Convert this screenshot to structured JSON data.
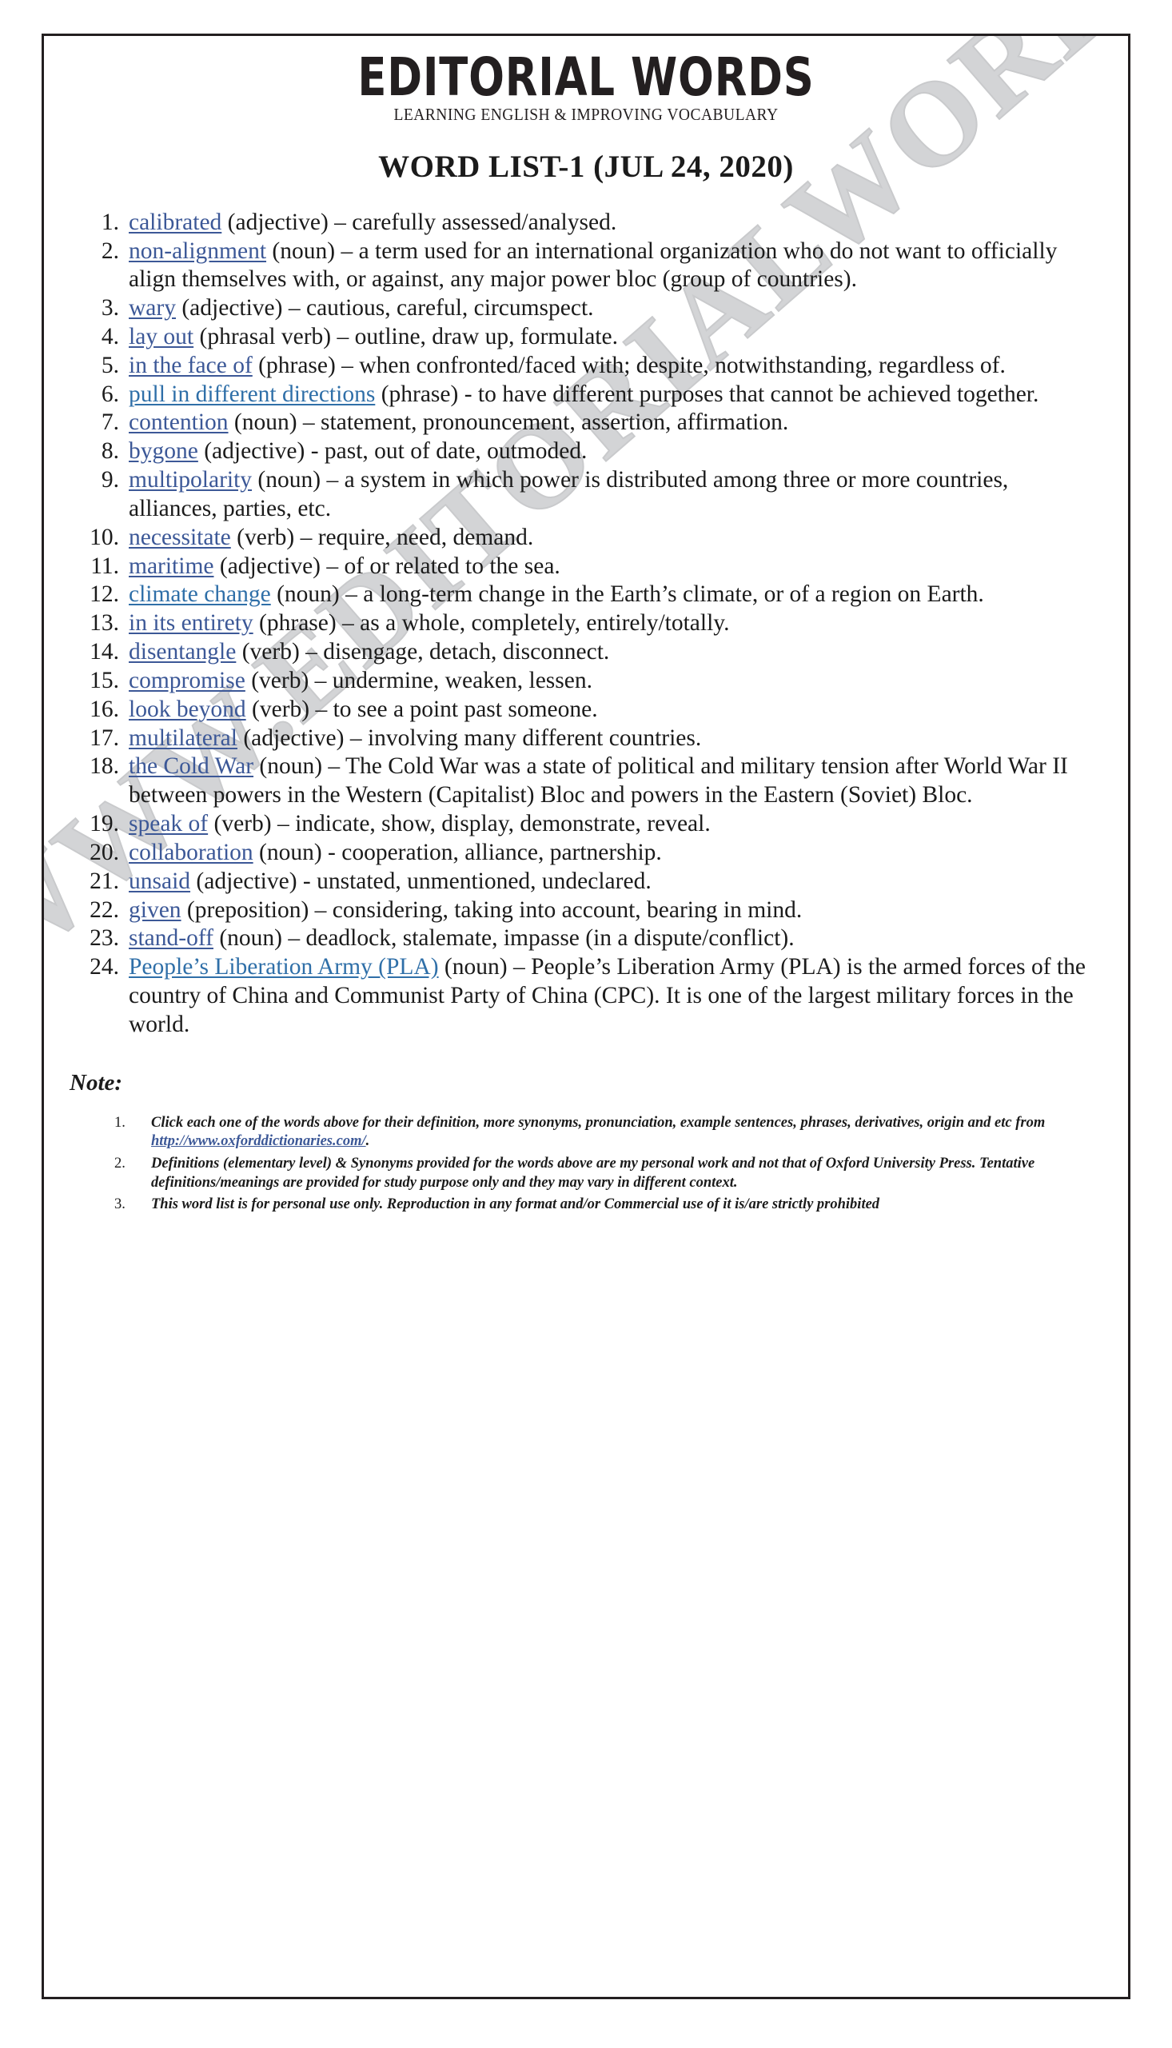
{
  "masthead": {
    "brand": "EDITORIAL WORDS",
    "tagline": "LEARNING ENGLISH & IMPROVING VOCABULARY"
  },
  "doc_title": "WORD LIST-1 (JUL 24, 2020)",
  "watermark": "WWW.EDITORIALWORDS.COM",
  "colors": {
    "link_blue": "#3c5897",
    "link_blue_alt": "#2f6fa8",
    "text_black": "#1b1b1b",
    "border": "#231f20",
    "watermark_gray": "#d3d4d6"
  },
  "words": [
    {
      "num": "1.",
      "term": "calibrated",
      "alt": false,
      "definition": " (adjective) – carefully assessed/analysed."
    },
    {
      "num": "2.",
      "term": "non-alignment",
      "alt": false,
      "definition": " (noun) – a term used for an international organization who do not want to officially align themselves with, or against, any major power bloc (group of countries)."
    },
    {
      "num": "3.",
      "term": "wary",
      "alt": false,
      "definition": " (adjective) – cautious, careful, circumspect."
    },
    {
      "num": "4.",
      "term": "lay out",
      "alt": false,
      "definition": " (phrasal verb) – outline, draw up, formulate."
    },
    {
      "num": "5.",
      "term": "in the face of",
      "alt": false,
      "definition": " (phrase) – when confronted/faced with; despite, notwithstanding, regardless of."
    },
    {
      "num": "6.",
      "term": "pull in different directions",
      "alt": true,
      "definition": " (phrase) - to have different purposes that cannot be achieved together."
    },
    {
      "num": "7.",
      "term": "contention",
      "alt": false,
      "definition": " (noun) – statement, pronouncement, assertion, affirmation."
    },
    {
      "num": "8.",
      "term": "bygone",
      "alt": false,
      "definition": " (adjective) - past, out of date, outmoded."
    },
    {
      "num": "9.",
      "term": "multipolarity",
      "alt": false,
      "definition": " (noun) – a system in which power is distributed among three or more countries, alliances, parties, etc."
    },
    {
      "num": "10.",
      "term": "necessitate",
      "alt": false,
      "definition": " (verb) – require, need, demand."
    },
    {
      "num": "11.",
      "term": "maritime",
      "alt": false,
      "definition": " (adjective) – of or related to the sea."
    },
    {
      "num": "12.",
      "term": "climate change",
      "alt": true,
      "definition": " (noun) – a long-term change in the Earth’s climate, or of a region on Earth."
    },
    {
      "num": "13.",
      "term": "in its entirety",
      "alt": false,
      "definition": " (phrase) – as a whole, completely, entirely/totally."
    },
    {
      "num": "14.",
      "term": "disentangle",
      "alt": false,
      "definition": " (verb) – disengage, detach, disconnect."
    },
    {
      "num": "15.",
      "term": "compromise",
      "alt": false,
      "definition": " (verb) – undermine, weaken, lessen."
    },
    {
      "num": "16.",
      "term": "look beyond",
      "alt": false,
      "definition": " (verb) – to see a point past someone."
    },
    {
      "num": "17.",
      "term": "multilateral",
      "alt": false,
      "definition": " (adjective) – involving many different countries."
    },
    {
      "num": "18.",
      "term": "the Cold War",
      "alt": false,
      "definition": " (noun) – The Cold War was a state of political and military tension after World War II between powers in the Western (Capitalist) Bloc and powers in the Eastern (Soviet) Bloc."
    },
    {
      "num": "19.",
      "term": "speak of",
      "alt": false,
      "definition": " (verb) – indicate, show, display, demonstrate, reveal."
    },
    {
      "num": "20.",
      "term": "collaboration",
      "alt": false,
      "definition": " (noun) - cooperation, alliance, partnership."
    },
    {
      "num": "21.",
      "term": "unsaid",
      "alt": false,
      "definition": " (adjective) - unstated, unmentioned, undeclared."
    },
    {
      "num": "22.",
      "term": "given",
      "alt": false,
      "definition": " (preposition) – considering, taking into account, bearing in mind."
    },
    {
      "num": "23.",
      "term": "stand-off",
      "alt": false,
      "definition": " (noun) – deadlock, stalemate, impasse (in a dispute/conflict)."
    },
    {
      "num": "24.",
      "term": "People’s Liberation Army (PLA)",
      "alt": true,
      "definition": " (noun) – People’s Liberation Army (PLA) is the armed forces of the country of China and Communist Party of China (CPC). It is one of the largest military forces in the world."
    }
  ],
  "note": {
    "heading": "Note:",
    "items": [
      {
        "num": "1.",
        "text_before": "Click each one of the words above for their definition, more synonyms, pronunciation, example sentences, phrases, derivatives, origin and etc from ",
        "link": "http://www.oxforddictionaries.com/",
        "text_after": "."
      },
      {
        "num": "2.",
        "text_before": "Definitions (elementary level) & Synonyms provided for the words above are my personal work and not that of Oxford University Press. Tentative definitions/meanings are provided for study purpose only and they may vary in different context.",
        "link": "",
        "text_after": ""
      },
      {
        "num": "3.",
        "text_before": "This word list is for personal use only. Reproduction in any format and/or Commercial use of it is/are strictly prohibited",
        "link": "",
        "text_after": ""
      }
    ]
  }
}
